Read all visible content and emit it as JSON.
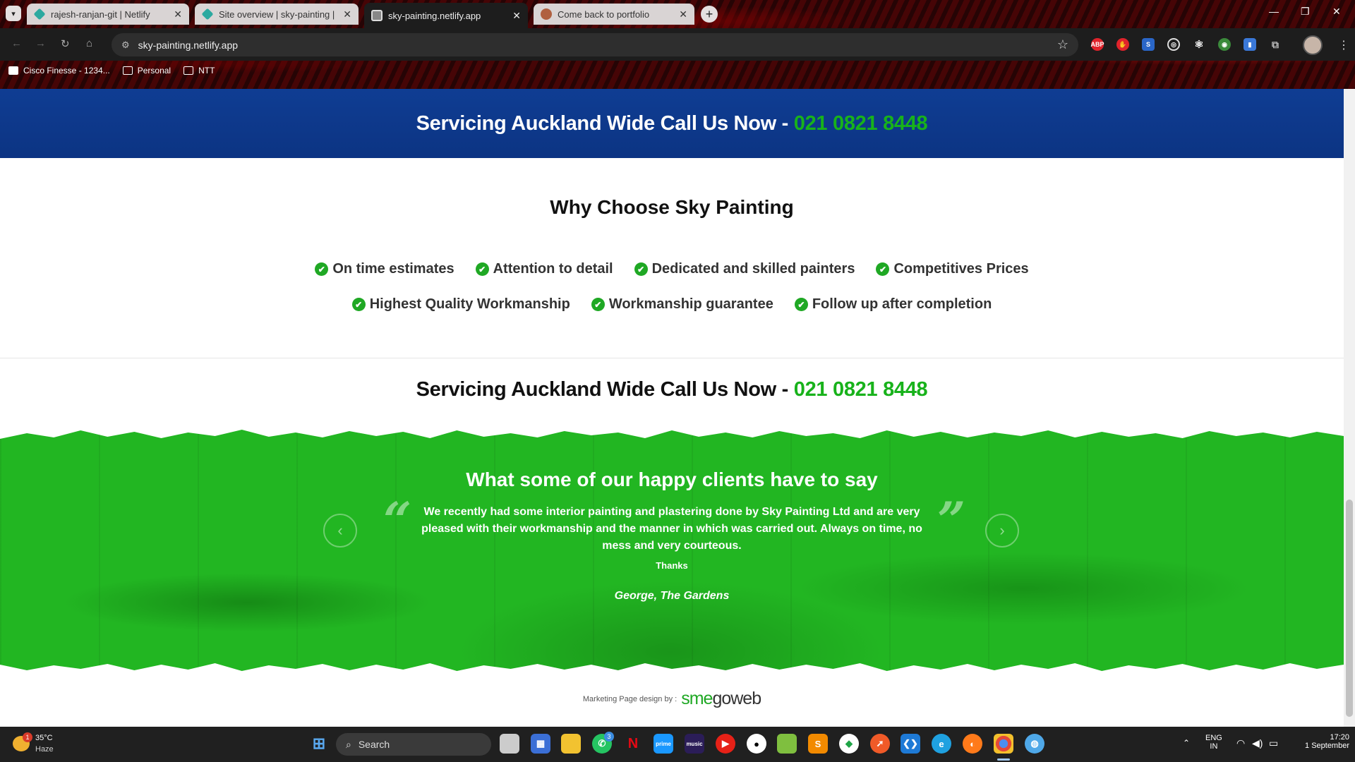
{
  "browser": {
    "tabs": [
      {
        "title": "rajesh-ranjan-git | Netlify",
        "favicon": "netlify-icon",
        "active": false
      },
      {
        "title": "Site overview | sky-painting | Ne",
        "favicon": "netlify-icon",
        "active": false
      },
      {
        "title": "sky-painting.netlify.app",
        "favicon": "page-icon",
        "active": true
      },
      {
        "title": "Come back to portfolio",
        "favicon": "avatar-icon",
        "active": false
      }
    ],
    "url": "sky-painting.netlify.app",
    "bookmarks": [
      "Cisco Finesse - 1234...",
      "Personal",
      "NTT"
    ],
    "extensions": [
      "ABP",
      "adblock",
      "S",
      "target",
      "gear",
      "paint",
      "file",
      "puzzle"
    ]
  },
  "page": {
    "cta_text": "Servicing Auckland Wide Call Us Now - ",
    "phone": "021 0821 8448",
    "why_title": "Why Choose Sky Painting",
    "features_row1": [
      "On time estimates",
      "Attention to detail",
      "Dedicated and skilled painters",
      "Competitives Prices"
    ],
    "features_row2": [
      "Highest Quality Workmanship",
      "Workmanship guarantee",
      "Follow up after completion"
    ],
    "testimonials": {
      "heading": "What some of our happy clients have to say",
      "quote": "We recently had some interior painting and plastering done by Sky Painting Ltd and are very pleased with their workmanship and the manner in which was carried out. Always on time, no mess and very courteous.",
      "thanks": "Thanks",
      "author": "George, The Gardens"
    },
    "footer": {
      "credit": "Marketing Page design by :",
      "logo_pre": "sme",
      "logo_post": "goweb"
    }
  },
  "taskbar": {
    "weather_temp": "35°C",
    "weather_desc": "Haze",
    "search_placeholder": "Search",
    "lang": "ENG",
    "region": "IN",
    "time": "17:20",
    "date": "1 September",
    "whatsapp_badge": "3",
    "weather_badge": "1"
  },
  "colors": {
    "brand_blue": "#0f3d93",
    "brand_green": "#1fa824",
    "phone_green": "#18b21b"
  }
}
